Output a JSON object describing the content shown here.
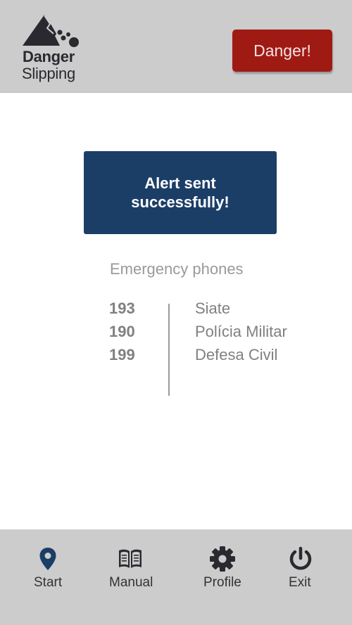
{
  "header": {
    "logo": {
      "title": "Danger",
      "subtitle": "Slipping",
      "icon": "mountain-rockslide-icon"
    },
    "danger_button_label": "Danger!"
  },
  "alert": {
    "message": "Alert sent successfully!"
  },
  "emergency": {
    "title": "Emergency phones",
    "phones": [
      {
        "number": "193",
        "name": "Siate"
      },
      {
        "number": "190",
        "name": "Polícia Militar"
      },
      {
        "number": "199",
        "name": "Defesa Civil"
      }
    ]
  },
  "nav": {
    "items": [
      {
        "label": "Start",
        "icon": "map-pin-icon"
      },
      {
        "label": "Manual",
        "icon": "book-icon"
      },
      {
        "label": "Profile",
        "icon": "gear-icon"
      },
      {
        "label": "Exit",
        "icon": "power-icon"
      }
    ]
  },
  "colors": {
    "header_bg": "#cccccc",
    "danger": "#a01a14",
    "alert_bg": "#1b3e67",
    "nav_active": "#1b3e67",
    "nav_icon": "#2b2930",
    "muted_text": "#808080"
  }
}
